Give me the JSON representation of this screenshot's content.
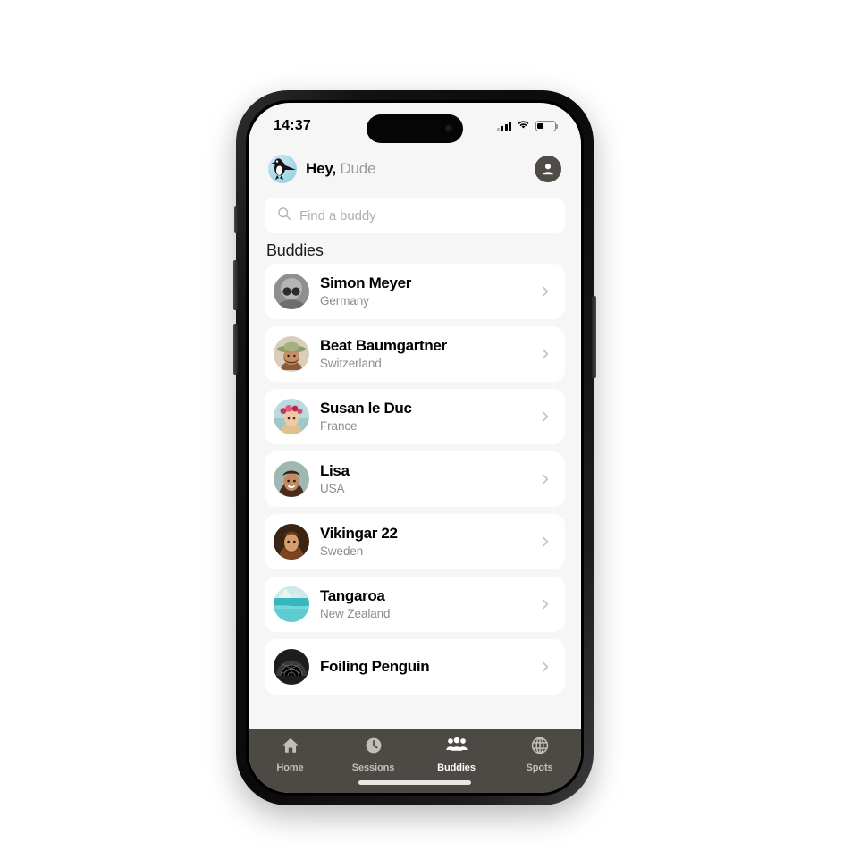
{
  "status_bar": {
    "time": "14:37",
    "cellular_icon": "cellular-bars-icon",
    "wifi_icon": "wifi-icon",
    "battery_icon": "battery-icon",
    "battery_level_percent": 38
  },
  "header": {
    "logo_icon": "penguin-logo-icon",
    "greeting_bold": "Hey,",
    "greeting_name": "Dude",
    "profile_icon": "person-circle-icon"
  },
  "search": {
    "icon": "search-icon",
    "placeholder": "Find a buddy",
    "value": ""
  },
  "section": {
    "title": "Buddies"
  },
  "buddies": [
    {
      "name": "Simon Meyer",
      "country": "Germany",
      "avatar": "avatar-grayscale-sunglasses",
      "chevron": "chevron-right-icon"
    },
    {
      "name": "Beat Baumgartner",
      "country": "Switzerland",
      "avatar": "avatar-man-hat-beard",
      "chevron": "chevron-right-icon"
    },
    {
      "name": "Susan le Duc",
      "country": "France",
      "avatar": "avatar-woman-flower-crown",
      "chevron": "chevron-right-icon"
    },
    {
      "name": "Lisa",
      "country": "USA",
      "avatar": "avatar-smiling-woman",
      "chevron": "chevron-right-icon"
    },
    {
      "name": "Vikingar 22",
      "country": "Sweden",
      "avatar": "avatar-viking-man",
      "chevron": "chevron-right-icon"
    },
    {
      "name": "Tangaroa",
      "country": "New Zealand",
      "avatar": "avatar-ocean-island",
      "chevron": "chevron-right-icon"
    },
    {
      "name": "Foiling Penguin",
      "country": "",
      "avatar": "avatar-dark-dome",
      "chevron": "chevron-right-icon"
    }
  ],
  "tabbar": {
    "active": "Buddies",
    "items": [
      {
        "label": "Home",
        "icon": "home-icon"
      },
      {
        "label": "Sessions",
        "icon": "clock-icon"
      },
      {
        "label": "Buddies",
        "icon": "people-icon"
      },
      {
        "label": "Spots",
        "icon": "globe-icon"
      }
    ]
  },
  "colors": {
    "page_background": "#f6f6f6",
    "card_background": "#ffffff",
    "tabbar_background": "#4d4945",
    "tab_active": "#ffffff",
    "tab_inactive": "#c2bfbb",
    "primary_text": "#000000",
    "secondary_text": "#8c8c8c",
    "placeholder_text": "#b0b0b0",
    "chevron": "#c2c2c2"
  }
}
